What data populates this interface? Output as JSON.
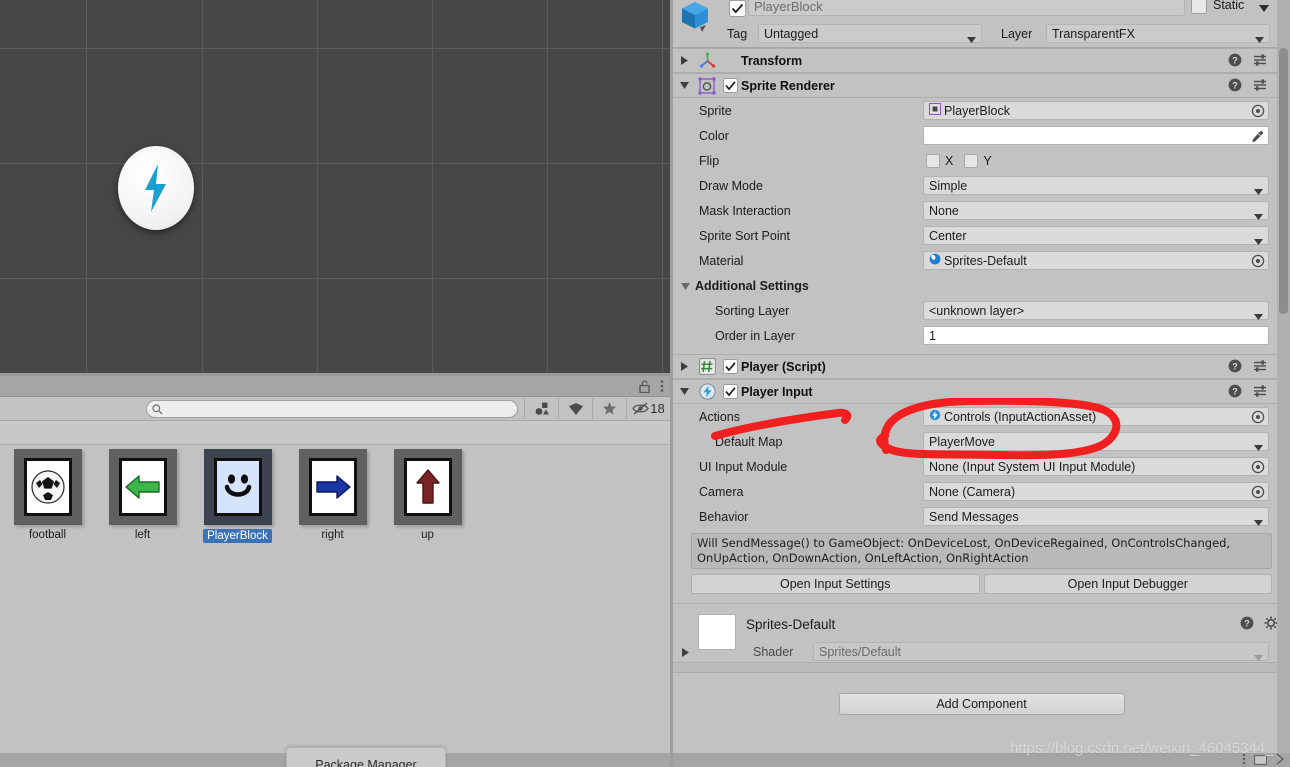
{
  "scene": {
    "background_color": "#464646",
    "grid_color": "#5b5b5b",
    "gizmo_name": "unity-lightning-gizmo",
    "gizmo_accent_color": "#1ba1d1"
  },
  "project_panel": {
    "search": {
      "value": "",
      "placeholder": ""
    },
    "toolbar_icons": [
      "asset-filter-icon",
      "label-filter-icon",
      "favorite-star-icon",
      "hidden-count-icon"
    ],
    "hidden_count": "18",
    "lock_icon": "lock-open-icon",
    "menu_icon": "kebab-menu-icon",
    "assets": [
      {
        "label": "football",
        "icon": "football-sprite",
        "selected": false
      },
      {
        "label": "left",
        "icon": "left-arrow-sprite",
        "selected": false
      },
      {
        "label": "PlayerBlock",
        "icon": "player-face-sprite",
        "selected": true
      },
      {
        "label": "right",
        "icon": "right-arrow-sprite",
        "selected": false
      },
      {
        "label": "up",
        "icon": "up-arrow-sprite",
        "selected": false
      }
    ],
    "bottom_tab": "Package Manager"
  },
  "inspector": {
    "gameobject": {
      "enabled": true,
      "name": "PlayerBlock",
      "static_label": "Static",
      "static_checked": false,
      "tag_label": "Tag",
      "tag_value": "Untagged",
      "layer_label": "Layer",
      "layer_value": "TransparentFX"
    },
    "components": [
      {
        "title": "Transform",
        "icon": "transform-axis-icon",
        "expanded": false,
        "has_checkbox": false
      },
      {
        "title": "Sprite Renderer",
        "icon": "sprite-renderer-icon",
        "expanded": true,
        "has_checkbox": true,
        "checked": true,
        "properties": [
          {
            "label": "Sprite",
            "value": "PlayerBlock",
            "type": "object",
            "icon": "sprite-asset-icon"
          },
          {
            "label": "Color",
            "value": "",
            "type": "color",
            "color": "#ffffff"
          },
          {
            "label": "Flip",
            "type": "flip",
            "x_label": "X",
            "y_label": "Y",
            "x_checked": false,
            "y_checked": false
          },
          {
            "label": "Draw Mode",
            "value": "Simple",
            "type": "dropdown"
          },
          {
            "label": "Mask Interaction",
            "value": "None",
            "type": "dropdown"
          },
          {
            "label": "Sprite Sort Point",
            "value": "Center",
            "type": "dropdown"
          },
          {
            "label": "Material",
            "value": "Sprites-Default",
            "type": "object",
            "icon": "material-ball-icon"
          }
        ],
        "additional_settings": {
          "title": "Additional Settings",
          "expanded": true,
          "properties": [
            {
              "label": "Sorting Layer",
              "value": "<unknown layer>",
              "type": "dropdown"
            },
            {
              "label": "Order in Layer",
              "value": "1",
              "type": "text"
            }
          ]
        }
      },
      {
        "title": "Player (Script)",
        "icon": "cs-script-icon",
        "expanded": false,
        "has_checkbox": true,
        "checked": true
      },
      {
        "title": "Player Input",
        "icon": "player-input-icon",
        "expanded": true,
        "has_checkbox": true,
        "checked": true,
        "properties": [
          {
            "label": "Actions",
            "value": "Controls (InputActionAsset)",
            "type": "object",
            "icon": "input-action-asset-icon"
          },
          {
            "label": "Default Map",
            "value": "PlayerMove",
            "type": "dropdown",
            "indent": 1
          },
          {
            "label": "UI Input Module",
            "value": "None (Input System UI Input Module)",
            "type": "object"
          },
          {
            "label": "Camera",
            "value": "None (Camera)",
            "type": "object"
          },
          {
            "label": "Behavior",
            "value": "Send Messages",
            "type": "dropdown"
          }
        ],
        "info_text": "Will SendMessage() to GameObject: OnDeviceLost, OnDeviceRegained, OnControlsChanged, OnUpAction, OnDownAction, OnLeftAction, OnRightAction",
        "buttons": [
          "Open Input Settings",
          "Open Input Debugger"
        ]
      }
    ],
    "material_preview": {
      "name": "Sprites-Default",
      "shader_label": "Shader",
      "shader_value": "Sprites/Default",
      "help_icon": "help-icon",
      "settings_icon": "gear-icon"
    },
    "add_component_label": "Add Component",
    "header_icons": {
      "help": "help-icon",
      "preset": "preset-sliders-icon",
      "menu": "kebab-menu-icon"
    }
  },
  "annotation": {
    "color": "#f02020",
    "shape": "hand-drawn-circle-highlight"
  },
  "watermark": "https://blog.csdn.net/weixin_46045344_"
}
